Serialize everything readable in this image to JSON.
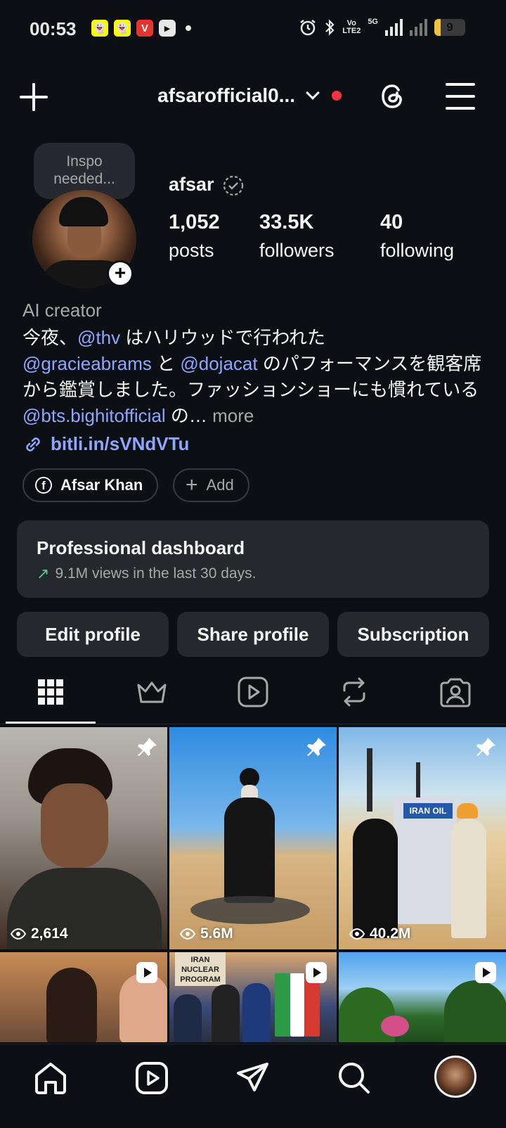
{
  "status_bar": {
    "time": "00:53",
    "volte_line1": "Vo",
    "volte_line2": "LTE2",
    "network": "5G",
    "battery": "9",
    "battery_level": 0.09,
    "app_icons": [
      "snapchat-icon",
      "snapchat-icon",
      "vivo-icon",
      "youtube-icon"
    ]
  },
  "header": {
    "username": "afsarofficial0...",
    "has_notification_dot": true
  },
  "profile": {
    "note": "Inspo needed...",
    "display_name": "afsar",
    "stats": [
      {
        "value": "1,052",
        "label": "posts"
      },
      {
        "value": "33.5K",
        "label": "followers"
      },
      {
        "value": "40",
        "label": "following"
      }
    ],
    "category": "AI creator",
    "bio": {
      "p1": "今夜、",
      "m1": "@thv",
      "p2": " はハリウッドで行われた",
      "m2": "@gracieabrams",
      "p3": " と ",
      "m3": "@dojacat",
      "p4": " のパフォーマンスを観客席から鑑賞しました。ファッションショーにも慣れている ",
      "m4": "@bts.bighitofficial",
      "p5": " の…",
      "more": " more"
    },
    "link": "bitli.in/sVNdVTu",
    "facebook_name": "Afsar Khan",
    "add_label": "Add"
  },
  "dashboard": {
    "title": "Professional dashboard",
    "subtitle": "9.1M views in the last 30 days."
  },
  "actions": {
    "edit": "Edit profile",
    "share": "Share profile",
    "subscription": "Subscription"
  },
  "tabs": [
    "grid-icon",
    "crown-icon",
    "reels-icon",
    "reposts-icon",
    "tagged-icon"
  ],
  "posts": [
    {
      "views": "2,614",
      "pinned": true
    },
    {
      "views": "5.6M",
      "pinned": true
    },
    {
      "views": "40.2M",
      "pinned": true,
      "sign": "IRAN OIL"
    },
    {
      "type": "reel"
    },
    {
      "type": "reel",
      "sign": "IRAN NUCLEAR PROGRAM"
    },
    {
      "type": "reel"
    }
  ],
  "bottom_nav": [
    "home-icon",
    "reels-icon",
    "messages-icon",
    "search-icon",
    "profile-avatar"
  ],
  "colors": {
    "background": "#0c1014",
    "card": "#25292e",
    "link": "#8ea6ff",
    "notification": "#ff3040",
    "trend": "#5cc98b"
  }
}
